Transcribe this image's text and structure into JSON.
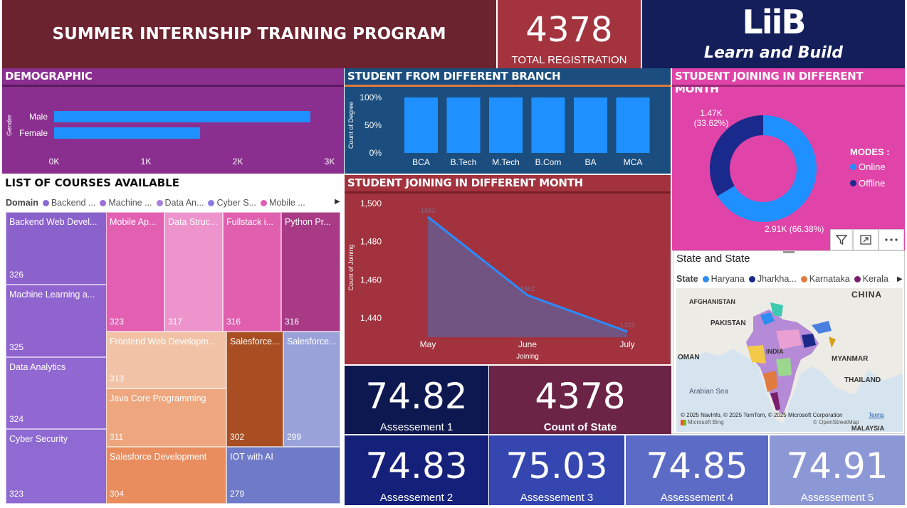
{
  "header": {
    "title": "SUMMER INTERNSHIP TRAINING PROGRAM",
    "total_value": "4378",
    "total_label": "TOTAL REGISTRATION",
    "logo_mark": "LiiB",
    "logo_text": "Learn and Build"
  },
  "demographic": {
    "title": "DEMOGRAPHIC",
    "axis_title": "Gender",
    "ticks": [
      "0K",
      "1K",
      "2K",
      "3K"
    ]
  },
  "branch": {
    "title": "STUDENT FROM DIFFERENT BRANCH",
    "axis_title": "Count of Degree",
    "ticks": [
      "100%",
      "50%",
      "0%"
    ]
  },
  "month_donut": {
    "title": "STUDENT JOINING IN DIFFERENT MONTH",
    "legend_title": "MODES :",
    "label_offline": "1.47K",
    "label_offline_pct": "(33.62%)",
    "label_online": "2.91K (66.38%)"
  },
  "courses": {
    "title": "LIST OF COURSES AVAILABLE",
    "legend_title": "Domain",
    "legend": [
      {
        "label": "Backend ...",
        "color": "#8a6bd1"
      },
      {
        "label": "Machine ...",
        "color": "#9c6fd8"
      },
      {
        "label": "Data An...",
        "color": "#a67ddb"
      },
      {
        "label": "Cyber S...",
        "color": "#8b7be0"
      },
      {
        "label": "Mobile ...",
        "color": "#e05fb5"
      }
    ],
    "tiles": [
      {
        "name": "Backend Web Devel...",
        "value": "326",
        "color": "#8b62cc"
      },
      {
        "name": "Machine Learning a...",
        "value": "325",
        "color": "#9064cf"
      },
      {
        "name": "Data Analytics",
        "value": "324",
        "color": "#9168d2"
      },
      {
        "name": "Cyber Security",
        "value": "323",
        "color": "#8f6ad3"
      },
      {
        "name": "Mobile Ap...",
        "value": "323",
        "color": "#e25fb2"
      },
      {
        "name": "Data Struc...",
        "value": "317",
        "color": "#ee94cc"
      },
      {
        "name": "Fullstack i...",
        "value": "316",
        "color": "#e05fae"
      },
      {
        "name": "Python Pr...",
        "value": "316",
        "color": "#a83a86"
      },
      {
        "name": "Frontend Web Developm...",
        "value": "313",
        "color": "#f1c2a6"
      },
      {
        "name": "Java Core Programming",
        "value": "311",
        "color": "#eda67e"
      },
      {
        "name": "Salesforce Development",
        "value": "304",
        "color": "#e98c5e"
      },
      {
        "name": "Salesforce...",
        "value": "302",
        "color": "#a84e22"
      },
      {
        "name": "Salesforce...",
        "value": "299",
        "color": "#9aa3d9"
      },
      {
        "name": "IOT with AI",
        "value": "279",
        "color": "#6f7ac8"
      }
    ]
  },
  "line_panel": {
    "title": "STUDENT JOINING IN DIFFERENT MONTH",
    "xlabel": "Joining",
    "ylabel": "Count of Joining"
  },
  "kpis": {
    "a1_value": "74.82",
    "a1_label": "Assessement 1",
    "state_value": "4378",
    "state_label": "Count of State",
    "a2_value": "74.83",
    "a2_label": "Assessement 2",
    "a3_value": "75.03",
    "a3_label": "Assessement 3",
    "a4_value": "74.85",
    "a4_label": "Assessement 4",
    "a5_value": "74.91",
    "a5_label": "Assessement 5"
  },
  "map": {
    "title": "State and State",
    "legend_title": "State",
    "legend": [
      {
        "label": "Haryana",
        "color": "#2d8cf0"
      },
      {
        "label": "Jharkha...",
        "color": "#1b2a8a"
      },
      {
        "label": "Karnataka",
        "color": "#e07a3f"
      },
      {
        "label": "Kerala",
        "color": "#7a1f6e"
      }
    ],
    "places": {
      "china": "CHINA",
      "afghanistan": "AFGHANISTAN",
      "pakistan": "PAKISTAN",
      "india": "INDIA",
      "oman": "OMAN",
      "myanmar": "MYANMAR",
      "arabian_sea": "Arabian Sea",
      "thailand": "THAILAND",
      "malaysia": "MALAYSIA"
    },
    "copyright": "© 2025 NavInfo, © 2025 TomTom, © 2025 Microsoft Corporation",
    "terms": "Terms",
    "bing": "Microsoft Bing",
    "osm": "© OpenStreetMap"
  },
  "colors": {
    "header_bg": "#6b2330",
    "total_bg": "#a3333d",
    "logo_bg": "#141e5a",
    "purple_panel": "#8a2f8f",
    "branch_panel": "#1b4e7f",
    "donut_panel": "#e044a8",
    "line_panel": "#a2323d",
    "bar_blue": "#1e90ff",
    "online": "#1e90ff",
    "offline": "#1a2a8c"
  },
  "chart_data": [
    {
      "type": "bar",
      "title": "DEMOGRAPHIC",
      "orientation": "horizontal",
      "categories": [
        "Male",
        "Female"
      ],
      "values": [
        2790,
        1590
      ],
      "ylabel": "Gender",
      "xlim": [
        0,
        3000
      ]
    },
    {
      "type": "bar",
      "title": "STUDENT FROM DIFFERENT BRANCH",
      "categories": [
        "BCA",
        "B.Tech",
        "M.Tech",
        "B.Com",
        "BA",
        "MCA"
      ],
      "values": [
        100,
        100,
        100,
        100,
        100,
        100
      ],
      "ylabel": "Count of Degree",
      "ylim": [
        0,
        100
      ]
    },
    {
      "type": "pie",
      "title": "STUDENT JOINING IN DIFFERENT MONTH",
      "categories": [
        "Online",
        "Offline"
      ],
      "values": [
        2906,
        1472
      ],
      "colors": [
        "#1e90ff",
        "#1a2a8c"
      ]
    },
    {
      "type": "area",
      "title": "STUDENT JOINING IN DIFFERENT MONTH",
      "categories": [
        "May",
        "June",
        "July"
      ],
      "values": [
        1493,
        1452,
        1433
      ],
      "data_labels": [
        "1493",
        "1452",
        "1433"
      ],
      "xlabel": "Joining",
      "ylabel": "Count of Joining",
      "ylim": [
        1430,
        1500
      ],
      "yticks": [
        "1,500",
        "1,480",
        "1,460",
        "1,440"
      ]
    }
  ]
}
